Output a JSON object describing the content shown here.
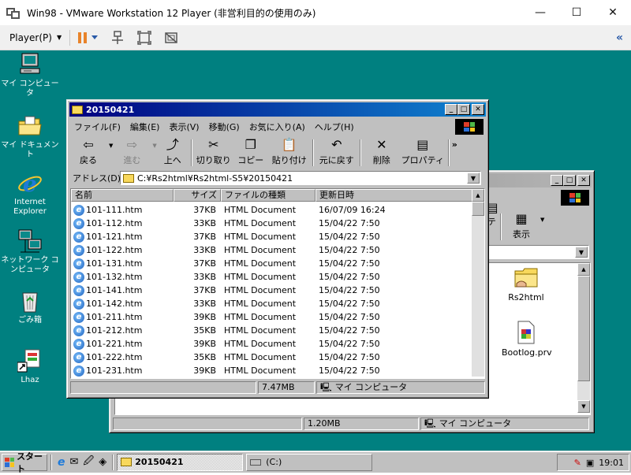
{
  "host": {
    "title": "Win98 - VMware Workstation 12 Player (非営利目的の使用のみ)",
    "menu_label": "Player(P)",
    "minimize": "—",
    "maximize": "☐",
    "close": "✕",
    "collapse": "«"
  },
  "desktop": {
    "icons": [
      {
        "label": "マイ コンピュータ"
      },
      {
        "label": "マイ ドキュメント"
      },
      {
        "label": "Internet Explorer"
      },
      {
        "label": "ネットワーク コンピュータ"
      },
      {
        "label": "ごみ箱"
      },
      {
        "label": "Lhaz"
      }
    ]
  },
  "front_window": {
    "title": "20150421",
    "menus": [
      "ファイル(F)",
      "編集(E)",
      "表示(V)",
      "移動(G)",
      "お気に入り(A)",
      "ヘルプ(H)"
    ],
    "toolbar": {
      "back": "戻る",
      "forward": "進む",
      "up": "上へ",
      "cut": "切り取り",
      "copy": "コピー",
      "paste": "貼り付け",
      "undo": "元に戻す",
      "delete": "削除",
      "properties": "プロパティ",
      "more": "»"
    },
    "address_label": "アドレス(D)",
    "address_value": "C:¥Rs2html¥Rs2html-S5¥20150421",
    "columns": {
      "name": "名前",
      "size": "サイズ",
      "type": "ファイルの種類",
      "date": "更新日時"
    },
    "files": [
      {
        "name": "101-111.htm",
        "size": "37KB",
        "type": "HTML Document",
        "date": "16/07/09 16:24"
      },
      {
        "name": "101-112.htm",
        "size": "33KB",
        "type": "HTML Document",
        "date": "15/04/22 7:50"
      },
      {
        "name": "101-121.htm",
        "size": "37KB",
        "type": "HTML Document",
        "date": "15/04/22 7:50"
      },
      {
        "name": "101-122.htm",
        "size": "33KB",
        "type": "HTML Document",
        "date": "15/04/22 7:50"
      },
      {
        "name": "101-131.htm",
        "size": "37KB",
        "type": "HTML Document",
        "date": "15/04/22 7:50"
      },
      {
        "name": "101-132.htm",
        "size": "33KB",
        "type": "HTML Document",
        "date": "15/04/22 7:50"
      },
      {
        "name": "101-141.htm",
        "size": "37KB",
        "type": "HTML Document",
        "date": "15/04/22 7:50"
      },
      {
        "name": "101-142.htm",
        "size": "33KB",
        "type": "HTML Document",
        "date": "15/04/22 7:50"
      },
      {
        "name": "101-211.htm",
        "size": "39KB",
        "type": "HTML Document",
        "date": "15/04/22 7:50"
      },
      {
        "name": "101-212.htm",
        "size": "35KB",
        "type": "HTML Document",
        "date": "15/04/22 7:50"
      },
      {
        "name": "101-221.htm",
        "size": "39KB",
        "type": "HTML Document",
        "date": "15/04/22 7:50"
      },
      {
        "name": "101-222.htm",
        "size": "35KB",
        "type": "HTML Document",
        "date": "15/04/22 7:50"
      },
      {
        "name": "101-231.htm",
        "size": "39KB",
        "type": "HTML Document",
        "date": "15/04/22 7:50"
      }
    ],
    "status_size": "7.47MB",
    "status_location": "マイ コンピュータ"
  },
  "back_window": {
    "toolbar_partial": "パティ",
    "view_button": "表示",
    "items": [
      {
        "label": "Rs2html"
      },
      {
        "label": "Bootlog.prv"
      }
    ],
    "status_size": "1.20MB",
    "status_location": "マイ コンピュータ"
  },
  "taskbar": {
    "start_label": "スタート",
    "tasks": [
      {
        "label": "20150421",
        "active": true
      },
      {
        "label": "(C:)",
        "active": false
      }
    ],
    "clock": "19:01"
  }
}
